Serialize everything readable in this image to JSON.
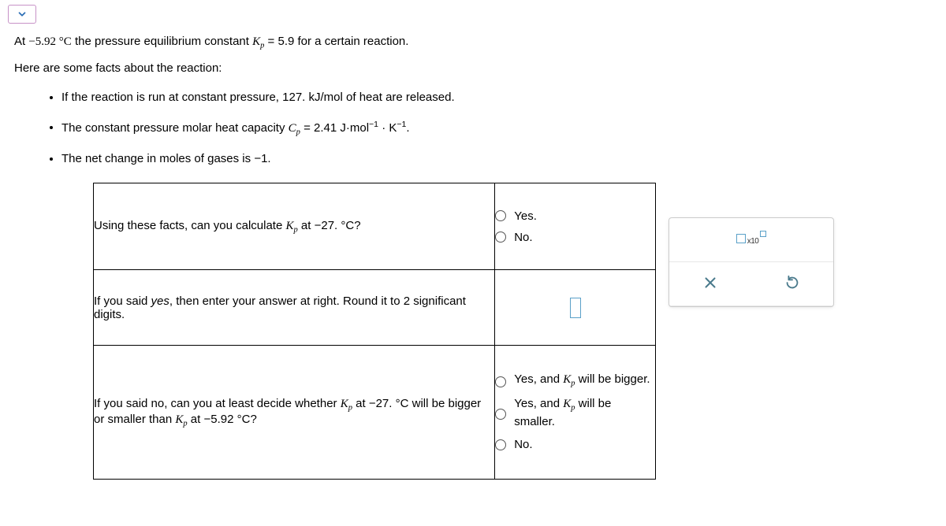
{
  "prompt": {
    "at_prefix": "At ",
    "temp1": "−5.92 °C",
    "mid1": " the pressure equilibrium constant ",
    "kp": "K",
    "kp_sub": "p",
    "eq": " = ",
    "kpval": "5.9",
    "suffix1": " for a certain reaction."
  },
  "facts_intro": "Here are some facts about the reaction:",
  "facts": {
    "f1a": "If the reaction is run at constant pressure, ",
    "f1b": "127. kJ/mol",
    "f1c": " of heat are released.",
    "f2a": "The constant pressure molar heat capacity ",
    "cp": "C",
    "cp_sub": "p",
    "f2eq": " = 2.41 J·mol",
    "f2exp1": "−1",
    "f2dot": " · K",
    "f2exp2": "−1",
    "f2end": ".",
    "f3a": "The net change in moles of gases is ",
    "f3b": "−1",
    "f3c": "."
  },
  "q1": {
    "text_a": "Using these facts, can you calculate ",
    "text_b": " at ",
    "temp2": "−27. °C",
    "text_c": "?",
    "yes": "Yes.",
    "no": "No."
  },
  "q2": {
    "italic_yes": "yes",
    "text_a": "If you said ",
    "text_b": ", then enter your answer at right. Round it to 2 significant digits."
  },
  "q3": {
    "text_a": "If you said no, can you at least decide whether ",
    "text_b": " at ",
    "temp2": "−27. °C",
    "text_c": " will be bigger or smaller than ",
    "text_d": " at ",
    "temp1": "−5.92 °C",
    "text_e": "?",
    "opt1a": "Yes, and ",
    "opt1b": " will be bigger.",
    "opt2a": "Yes, and ",
    "opt2b": " will be smaller.",
    "no": "No."
  },
  "keypad": {
    "x10": "x10"
  }
}
